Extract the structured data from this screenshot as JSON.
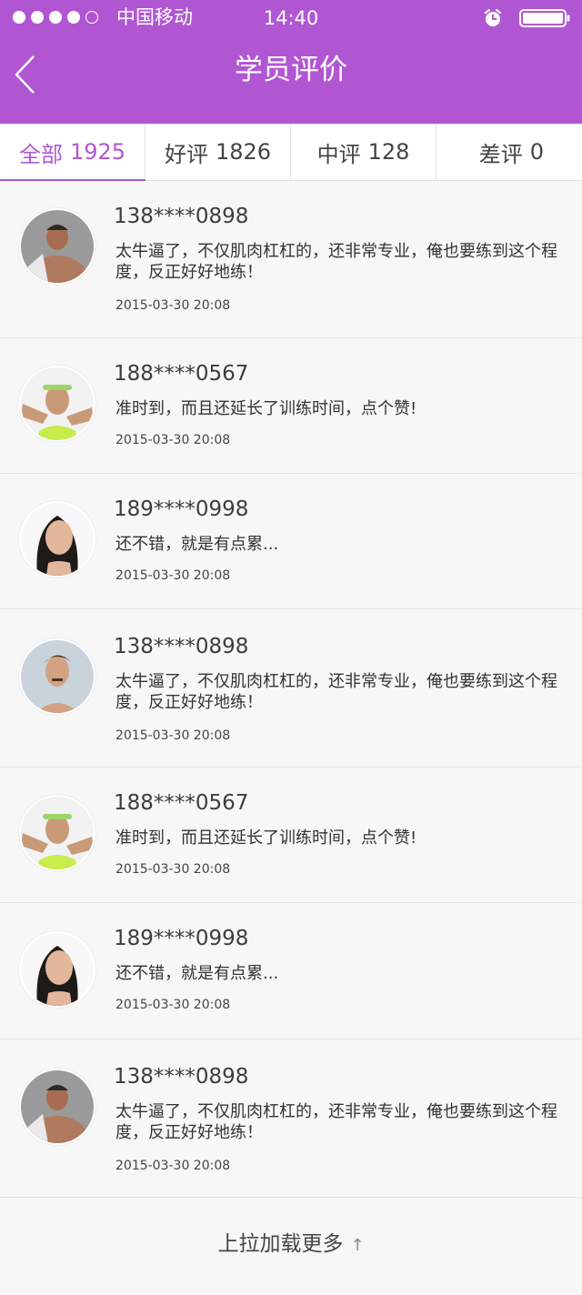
{
  "status_bar": {
    "carrier": "中国移动",
    "time": "14:40",
    "signal_dots_filled": 4,
    "signal_dots_total": 5
  },
  "nav": {
    "title": "学员评价",
    "back_icon": "chevron-left-icon"
  },
  "colors": {
    "brand": "#b156d3",
    "background": "#f7f7f7"
  },
  "tabs": [
    {
      "label": "全部",
      "count": "1925",
      "active": true
    },
    {
      "label": "好评",
      "count": "1826",
      "active": false
    },
    {
      "label": "中评",
      "count": "128",
      "active": false
    },
    {
      "label": "差评",
      "count": "0",
      "active": false
    }
  ],
  "reviews": [
    {
      "phone": "138****0898",
      "comment": "太牛逼了，不仅肌肉杠杠的，还非常专业，俺也要练到这个程度，反正好好地练！",
      "time": "2015-03-30 20:08",
      "avatar": "male-bodybuilder-avatar"
    },
    {
      "phone": "188****0567",
      "comment": "准时到，而且还延长了训练时间，点个赞!",
      "time": "2015-03-30 20:08",
      "avatar": "female-headband-avatar"
    },
    {
      "phone": "189****0998",
      "comment": "还不错，就是有点累...",
      "time": "2015-03-30 20:08",
      "avatar": "female-portrait-avatar"
    },
    {
      "phone": "138****0898",
      "comment": "太牛逼了，不仅肌肉杠杠的，还非常专业，俺也要练到这个程度，反正好好地练！",
      "time": "2015-03-30 20:08",
      "avatar": "male-mustache-avatar"
    },
    {
      "phone": "188****0567",
      "comment": "准时到，而且还延长了训练时间，点个赞!",
      "time": "2015-03-30 20:08",
      "avatar": "female-headband-avatar"
    },
    {
      "phone": "189****0998",
      "comment": "还不错，就是有点累...",
      "time": "2015-03-30 20:08",
      "avatar": "female-portrait-avatar"
    },
    {
      "phone": "138****0898",
      "comment": "太牛逼了，不仅肌肉杠杠的，还非常专业，俺也要练到这个程度，反正好好地练！",
      "time": "2015-03-30 20:08",
      "avatar": "male-bodybuilder-avatar"
    }
  ],
  "load_more": {
    "label": "上拉加载更多",
    "arrow": "↑"
  }
}
